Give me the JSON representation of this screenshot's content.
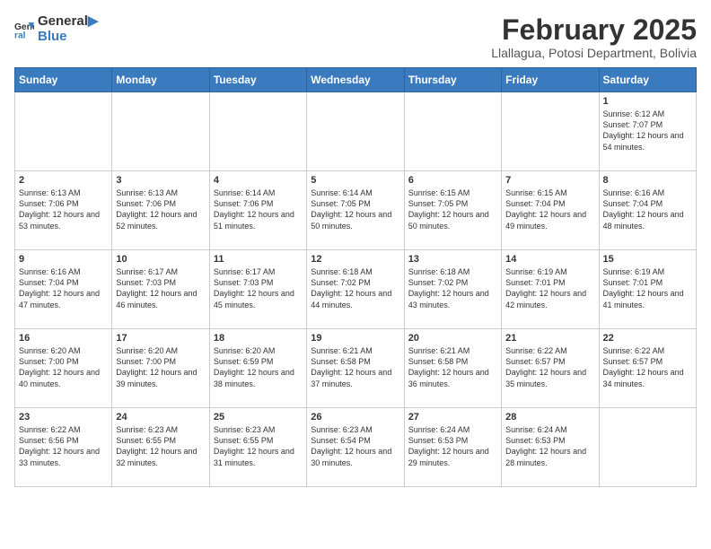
{
  "header": {
    "logo_general": "General",
    "logo_blue": "Blue",
    "month": "February 2025",
    "location": "Llallagua, Potosi Department, Bolivia"
  },
  "weekdays": [
    "Sunday",
    "Monday",
    "Tuesday",
    "Wednesday",
    "Thursday",
    "Friday",
    "Saturday"
  ],
  "weeks": [
    [
      {
        "day": "",
        "info": ""
      },
      {
        "day": "",
        "info": ""
      },
      {
        "day": "",
        "info": ""
      },
      {
        "day": "",
        "info": ""
      },
      {
        "day": "",
        "info": ""
      },
      {
        "day": "",
        "info": ""
      },
      {
        "day": "1",
        "info": "Sunrise: 6:12 AM\nSunset: 7:07 PM\nDaylight: 12 hours and 54 minutes."
      }
    ],
    [
      {
        "day": "2",
        "info": "Sunrise: 6:13 AM\nSunset: 7:06 PM\nDaylight: 12 hours and 53 minutes."
      },
      {
        "day": "3",
        "info": "Sunrise: 6:13 AM\nSunset: 7:06 PM\nDaylight: 12 hours and 52 minutes."
      },
      {
        "day": "4",
        "info": "Sunrise: 6:14 AM\nSunset: 7:06 PM\nDaylight: 12 hours and 51 minutes."
      },
      {
        "day": "5",
        "info": "Sunrise: 6:14 AM\nSunset: 7:05 PM\nDaylight: 12 hours and 50 minutes."
      },
      {
        "day": "6",
        "info": "Sunrise: 6:15 AM\nSunset: 7:05 PM\nDaylight: 12 hours and 50 minutes."
      },
      {
        "day": "7",
        "info": "Sunrise: 6:15 AM\nSunset: 7:04 PM\nDaylight: 12 hours and 49 minutes."
      },
      {
        "day": "8",
        "info": "Sunrise: 6:16 AM\nSunset: 7:04 PM\nDaylight: 12 hours and 48 minutes."
      }
    ],
    [
      {
        "day": "9",
        "info": "Sunrise: 6:16 AM\nSunset: 7:04 PM\nDaylight: 12 hours and 47 minutes."
      },
      {
        "day": "10",
        "info": "Sunrise: 6:17 AM\nSunset: 7:03 PM\nDaylight: 12 hours and 46 minutes."
      },
      {
        "day": "11",
        "info": "Sunrise: 6:17 AM\nSunset: 7:03 PM\nDaylight: 12 hours and 45 minutes."
      },
      {
        "day": "12",
        "info": "Sunrise: 6:18 AM\nSunset: 7:02 PM\nDaylight: 12 hours and 44 minutes."
      },
      {
        "day": "13",
        "info": "Sunrise: 6:18 AM\nSunset: 7:02 PM\nDaylight: 12 hours and 43 minutes."
      },
      {
        "day": "14",
        "info": "Sunrise: 6:19 AM\nSunset: 7:01 PM\nDaylight: 12 hours and 42 minutes."
      },
      {
        "day": "15",
        "info": "Sunrise: 6:19 AM\nSunset: 7:01 PM\nDaylight: 12 hours and 41 minutes."
      }
    ],
    [
      {
        "day": "16",
        "info": "Sunrise: 6:20 AM\nSunset: 7:00 PM\nDaylight: 12 hours and 40 minutes."
      },
      {
        "day": "17",
        "info": "Sunrise: 6:20 AM\nSunset: 7:00 PM\nDaylight: 12 hours and 39 minutes."
      },
      {
        "day": "18",
        "info": "Sunrise: 6:20 AM\nSunset: 6:59 PM\nDaylight: 12 hours and 38 minutes."
      },
      {
        "day": "19",
        "info": "Sunrise: 6:21 AM\nSunset: 6:58 PM\nDaylight: 12 hours and 37 minutes."
      },
      {
        "day": "20",
        "info": "Sunrise: 6:21 AM\nSunset: 6:58 PM\nDaylight: 12 hours and 36 minutes."
      },
      {
        "day": "21",
        "info": "Sunrise: 6:22 AM\nSunset: 6:57 PM\nDaylight: 12 hours and 35 minutes."
      },
      {
        "day": "22",
        "info": "Sunrise: 6:22 AM\nSunset: 6:57 PM\nDaylight: 12 hours and 34 minutes."
      }
    ],
    [
      {
        "day": "23",
        "info": "Sunrise: 6:22 AM\nSunset: 6:56 PM\nDaylight: 12 hours and 33 minutes."
      },
      {
        "day": "24",
        "info": "Sunrise: 6:23 AM\nSunset: 6:55 PM\nDaylight: 12 hours and 32 minutes."
      },
      {
        "day": "25",
        "info": "Sunrise: 6:23 AM\nSunset: 6:55 PM\nDaylight: 12 hours and 31 minutes."
      },
      {
        "day": "26",
        "info": "Sunrise: 6:23 AM\nSunset: 6:54 PM\nDaylight: 12 hours and 30 minutes."
      },
      {
        "day": "27",
        "info": "Sunrise: 6:24 AM\nSunset: 6:53 PM\nDaylight: 12 hours and 29 minutes."
      },
      {
        "day": "28",
        "info": "Sunrise: 6:24 AM\nSunset: 6:53 PM\nDaylight: 12 hours and 28 minutes."
      },
      {
        "day": "",
        "info": ""
      }
    ]
  ]
}
